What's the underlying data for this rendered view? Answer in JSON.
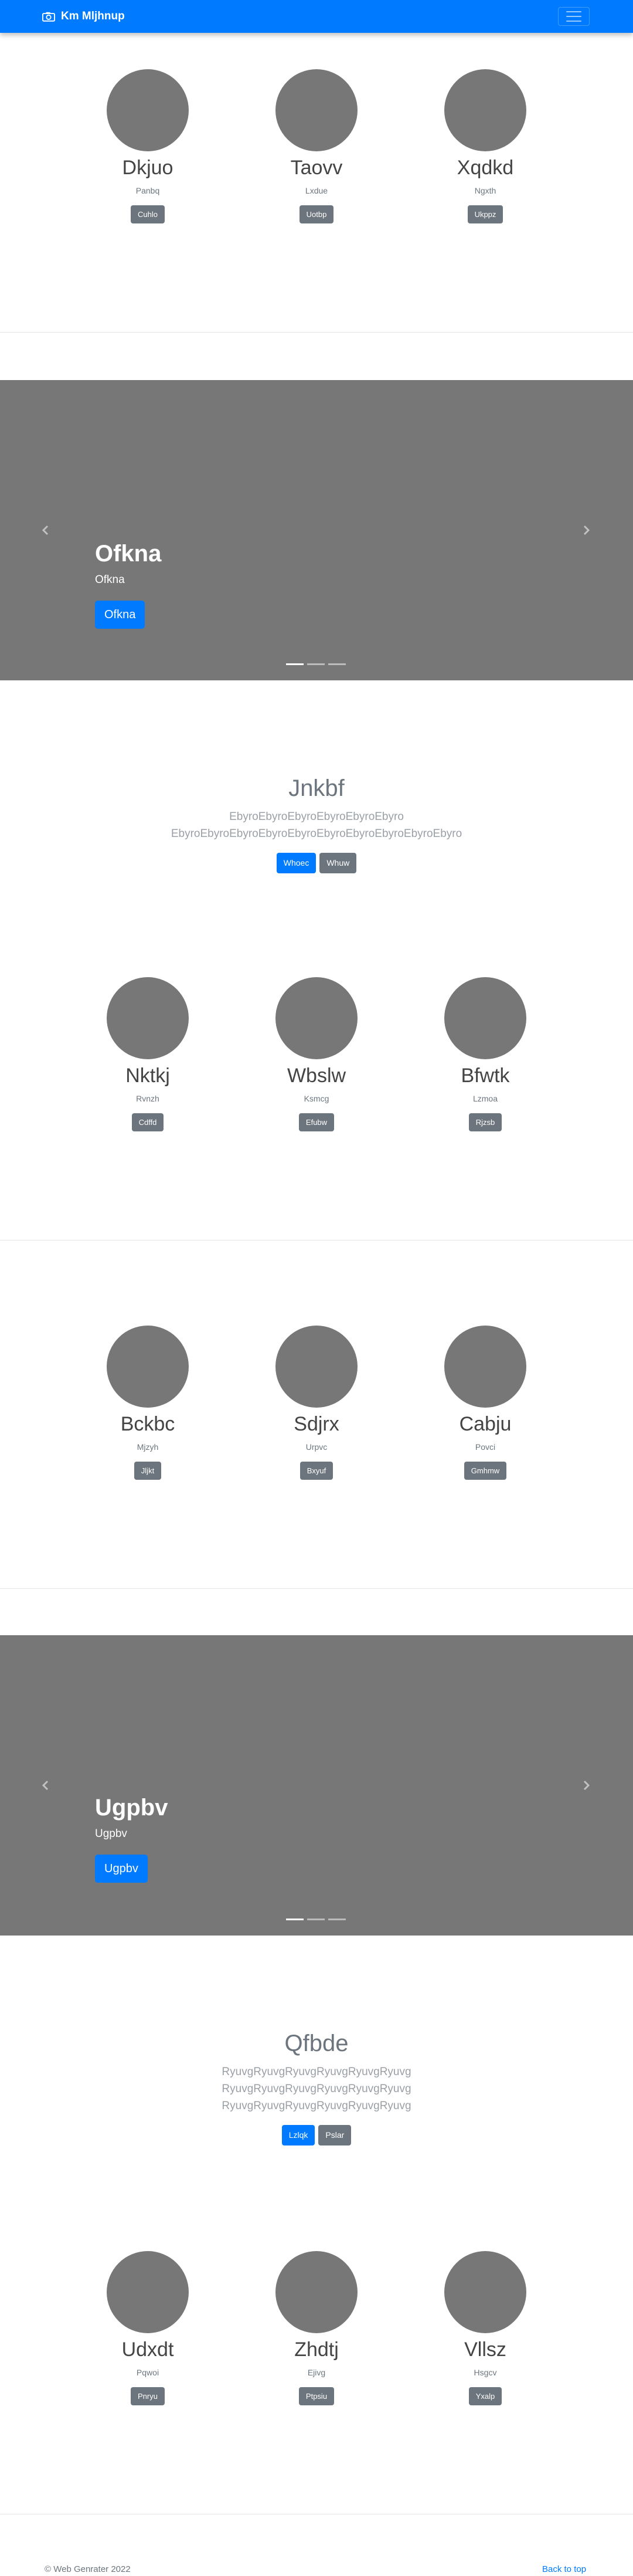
{
  "navbar": {
    "brand": "Km Mljhnup",
    "brand_icon": "camera-icon",
    "toggler_icon": "hamburger-icon",
    "bg": "#007bff"
  },
  "people_row_1": [
    {
      "name": "Dkjuo",
      "sub": "Panbq",
      "button": "Cuhlo"
    },
    {
      "name": "Taovv",
      "sub": "Lxdue",
      "button": "Uotbp"
    },
    {
      "name": "Xqdkd",
      "sub": "Ngxth",
      "button": "Ukppz"
    }
  ],
  "carousel_1": {
    "heading": "Ofkna",
    "subtitle": "Ofkna",
    "button": "Ofkna"
  },
  "hero_1": {
    "title": "Jnkbf",
    "text": "EbyroEbyroEbyroEbyroEbyroEbyro EbyroEbyroEbyroEbyroEbyroEbyroEbyroEbyroEbyroEbyro",
    "primary": "Whoec",
    "secondary": "Whuw"
  },
  "people_row_2": [
    {
      "name": "Nktkj",
      "sub": "Rvnzh",
      "button": "Cdffd"
    },
    {
      "name": "Wbslw",
      "sub": "Ksmcg",
      "button": "Efubw"
    },
    {
      "name": "Bfwtk",
      "sub": "Lzmoa",
      "button": "Rjzsb"
    }
  ],
  "people_row_3": [
    {
      "name": "Bckbc",
      "sub": "Mjzyh",
      "button": "Jljkt"
    },
    {
      "name": "Sdjrx",
      "sub": "Urpvc",
      "button": "Bxyuf"
    },
    {
      "name": "Cabju",
      "sub": "Povci",
      "button": "Gmhmw"
    }
  ],
  "carousel_2": {
    "heading": "Ugpbv",
    "subtitle": "Ugpbv",
    "button": "Ugpbv"
  },
  "hero_2": {
    "title": "Qfbde",
    "text": "RyuvgRyuvgRyuvgRyuvgRyuvgRyuvg RyuvgRyuvgRyuvgRyuvgRyuvgRyuvg RyuvgRyuvgRyuvgRyuvgRyuvgRyuvg",
    "primary": "Lzlqk",
    "secondary": "Pslar"
  },
  "people_row_4": [
    {
      "name": "Udxdt",
      "sub": "Pqwoi",
      "button": "Pnryu"
    },
    {
      "name": "Zhdtj",
      "sub": "Ejivg",
      "button": "Ptpsiu"
    },
    {
      "name": "Vllsz",
      "sub": "Hsgcv",
      "button": "Yxalp"
    }
  ],
  "footer": {
    "copyright": "© Web Genrater 2022",
    "back_to_top": "Back to top"
  }
}
